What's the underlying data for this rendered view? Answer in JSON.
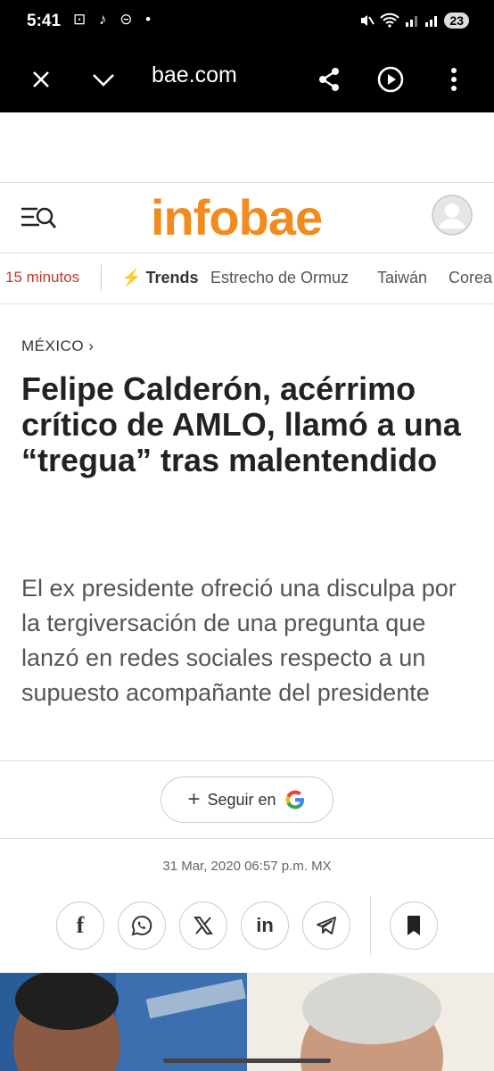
{
  "status_bar": {
    "time": "5:41",
    "left_icons": "⊡ ♪ ⊝ •",
    "battery": "23"
  },
  "browser": {
    "url": "bae.com",
    "icons": [
      "close-icon",
      "chevron-down-icon",
      "share-icon",
      "play-icon",
      "more-vert-icon"
    ]
  },
  "header": {
    "logo": "infobae",
    "logo_color": "#f18a1f"
  },
  "trends": {
    "time_label": "15 minutos",
    "trends_label": "Trends",
    "items": [
      "Estrecho de Ormuz",
      "Taiwán",
      "Corea"
    ]
  },
  "article": {
    "section": "MÉXICO",
    "headline": "Felipe Calderón, acérrimo crítico de AMLO, llamó a una “tregua” tras malentendido",
    "subheadline": "El ex presidente ofreció una disculpa por la tergiversación de una pregunta que lanzó en redes sociales respecto a un supuesto acompañante del presidente",
    "follow_label": "Seguir en",
    "date": "31 Mar, 2020 06:57 p.m. MX"
  },
  "share": {
    "facebook": "f",
    "linkedin": "in"
  }
}
